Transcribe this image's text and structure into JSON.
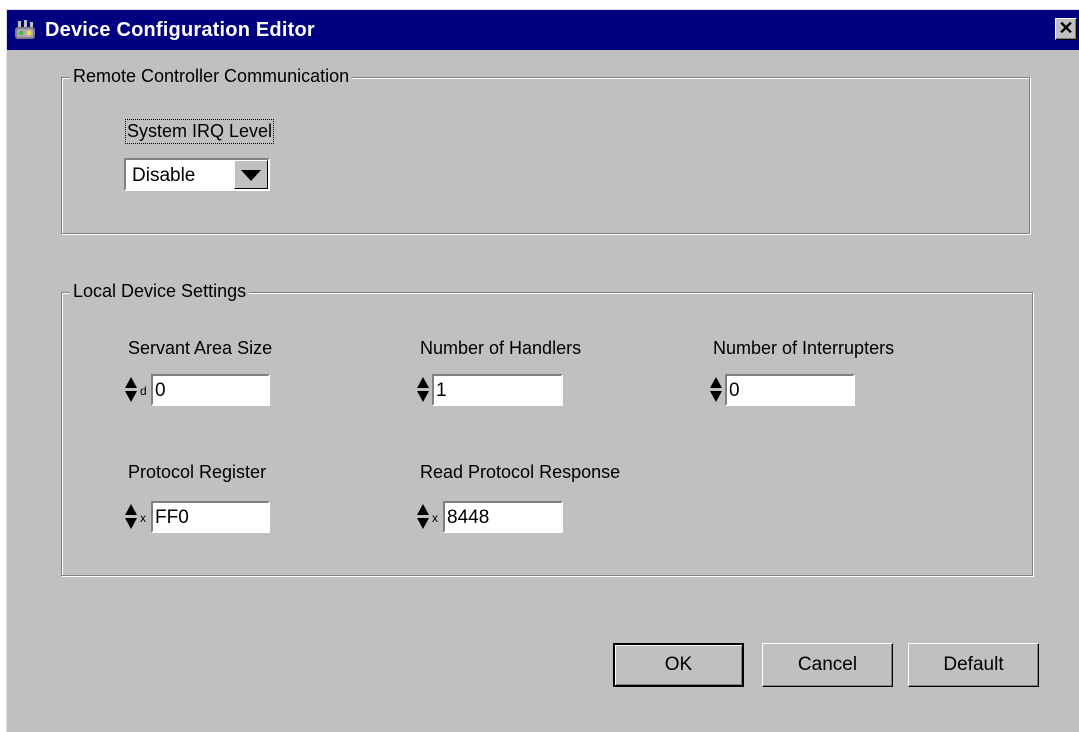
{
  "window": {
    "title": "Device Configuration Editor",
    "close_symbol": "✕",
    "app_icon": "device-icon"
  },
  "remote_group": {
    "legend": "Remote Controller Communication",
    "irq_label": "System IRQ Level",
    "irq_value": "Disable"
  },
  "local_group": {
    "legend": "Local Device Settings",
    "servant_area_size": {
      "label": "Servant Area Size",
      "radix": "d",
      "value": "0"
    },
    "number_of_handlers": {
      "label": "Number of Handlers",
      "radix": "",
      "value": "1"
    },
    "number_of_interrupters": {
      "label": "Number of Interrupters",
      "radix": "",
      "value": "0"
    },
    "protocol_register": {
      "label": "Protocol Register",
      "radix": "x",
      "value": "FF0"
    },
    "read_protocol_response": {
      "label": "Read Protocol Response",
      "radix": "x",
      "value": "8448"
    }
  },
  "buttons": {
    "ok": "OK",
    "cancel": "Cancel",
    "default": "Default"
  }
}
